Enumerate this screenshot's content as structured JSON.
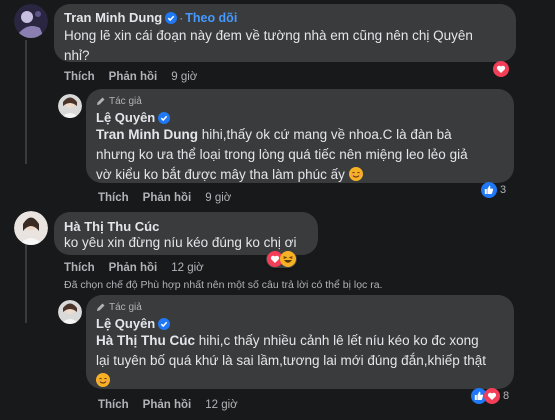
{
  "colors": {
    "background": "#18191a",
    "bubble": "#3a3b3c",
    "link": "#4599ff",
    "like_blue": "#2078f4",
    "love_red": "#f33e58",
    "haha_yellow": "#f7b125"
  },
  "comment1": {
    "name": "Tran Minh Dung",
    "follow": "Theo dõi",
    "dot": "·",
    "text_line1": "Hong lẽ xin cái đoạn này đem về tường nhà em cũng nên chị Quyên",
    "text_line2": "nhỉ?",
    "actions": {
      "like": "Thích",
      "reply": "Phản hồi",
      "time": "9 giờ"
    },
    "reaction_icon": "love-icon"
  },
  "reply1": {
    "author_label": "Tác giả",
    "name": "Lệ Quyên",
    "mention": "Tran Minh Dung",
    "text_line1": " hihi,thấy ok cứ mang về nhoa.C là đàn bà",
    "text_line2": "nhưng ko ưa thể loại trong lòng quá tiếc nên miệng leo lẻo giả",
    "text_line3": "vờ kiểu ko bắt được mây tha làm phúc ấy",
    "emoji": "smiling-face-icon",
    "actions": {
      "like": "Thích",
      "reply": "Phản hồi",
      "time": "9 giờ"
    },
    "reaction_count": "3",
    "reaction_icon": "like-icon"
  },
  "comment2": {
    "name": "Hà Thị Thu Cúc",
    "text": "ko yêu xin đừng níu kéo đúng ko chị ơi",
    "actions": {
      "like": "Thích",
      "reply": "Phản hồi",
      "time": "12 giờ"
    },
    "reaction_icons": [
      "love-icon",
      "haha-icon"
    ]
  },
  "filter_notice": "Đã chọn chế độ Phù hợp nhất nên một số câu trả lời có thể bị lọc ra.",
  "reply2": {
    "author_label": "Tác giả",
    "name": "Lệ Quyên",
    "mention": "Hà Thị Thu Cúc",
    "text_line1": " hihi,c thấy nhiều cảnh lê lết níu kéo ko đc xong",
    "text_line2": "lại tuyên bố quá khứ là sai lầm,tương lai mới đúng đắn,khiếp thật",
    "emoji": "smiling-face-icon",
    "actions": {
      "like": "Thích",
      "reply": "Phản hồi",
      "time": "12 giờ"
    },
    "reaction_count": "8",
    "reaction_icons": [
      "like-icon",
      "love-icon"
    ]
  }
}
